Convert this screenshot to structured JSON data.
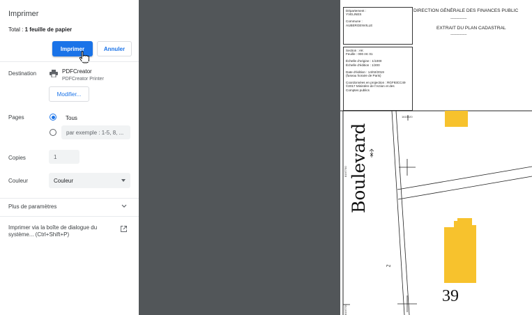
{
  "panel": {
    "title": "Imprimer",
    "total_prefix": "Total : ",
    "total_value": "1 feuille de papier",
    "print_label": "Imprimer",
    "cancel_label": "Annuler",
    "destination": {
      "label": "Destination",
      "printer_name": "PDFCreator",
      "printer_sub": "PDFCreator Printer",
      "modify_label": "Modifier..."
    },
    "pages": {
      "label": "Pages",
      "all_label": "Tous",
      "custom_placeholder": "par exemple : 1-5, 8, ..."
    },
    "copies": {
      "label": "Copies",
      "value": "1"
    },
    "color": {
      "label": "Couleur",
      "value": "Couleur"
    },
    "more_label": "Plus de paramètres",
    "system_dialog": "Imprimer via la boîte de dialogue du système... (Ctrl+Shift+P)"
  },
  "preview": {
    "dept_label": "Département :",
    "dept_value": "YVELINES",
    "commune_label": "Commune :",
    "commune_value": "AUBERGENVILLE",
    "header_title": "DIRECTION GÉNÉRALE DES FINANCES PUBLIC",
    "header_sub": "EXTRAIT DU PLAN CADASTRAL",
    "dashes": "-----------------",
    "section": "Section : AK",
    "feuille": "Feuille : 000 AK 01",
    "echelle_origine": "Échelle d'origine : 1/1000",
    "echelle_edition": "Échelle d'édition : 1/200",
    "date_edition": "Date d'édition : 14/02/2019",
    "fuseau": "(fuseau horaire de Paris)",
    "coord_proj": "Coordonnées en projection : RGF93CC49",
    "copyright_1": "©2017 Ministère de l'Action et des",
    "copyright_2": "Comptes publics",
    "coord_top": "1615520",
    "coord_left_1": "8197730",
    "coord_left_2": "8197720",
    "road_label": "Boulevard",
    "parcel_number": "39",
    "small_number": "2"
  },
  "colors": {
    "accent": "#1a73e8",
    "dark_bg": "#525659",
    "building": "#f7c22d"
  }
}
